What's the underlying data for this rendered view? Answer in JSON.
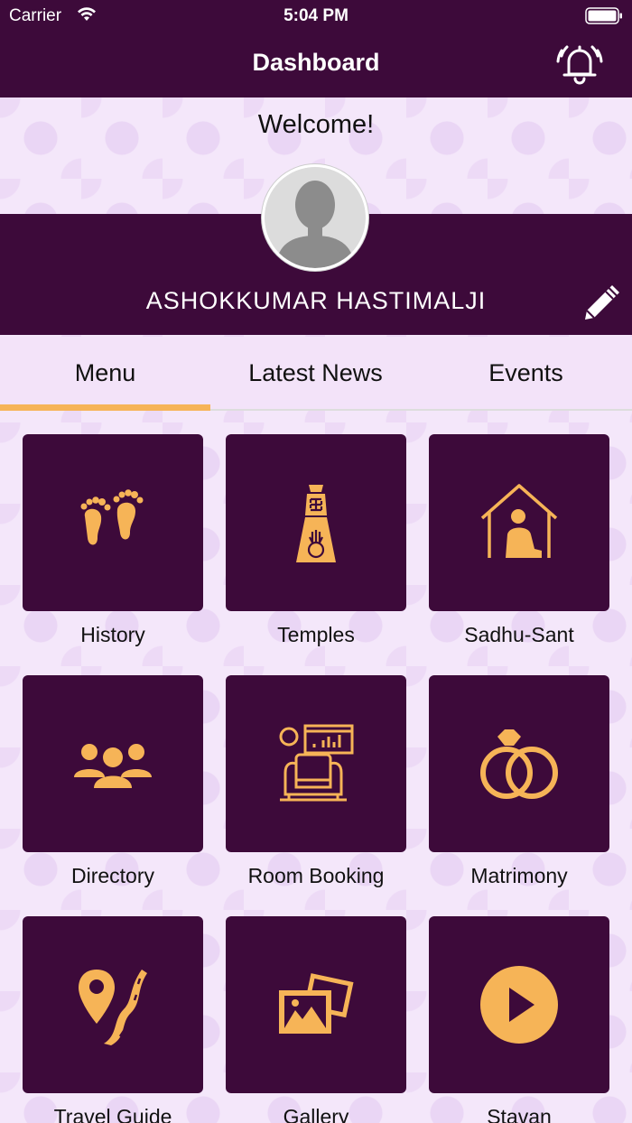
{
  "status_bar": {
    "carrier": "Carrier",
    "time": "5:04 PM"
  },
  "header": {
    "title": "Dashboard"
  },
  "welcome": "Welcome!",
  "user": {
    "name": "ASHOKKUMAR HASTIMALJI"
  },
  "tabs": [
    {
      "label": "Menu",
      "active": true
    },
    {
      "label": "Latest News",
      "active": false
    },
    {
      "label": "Events",
      "active": false
    }
  ],
  "menu": [
    {
      "label": "History",
      "icon": "footprints-icon"
    },
    {
      "label": "Temples",
      "icon": "temple-pillar-icon"
    },
    {
      "label": "Sadhu-Sant",
      "icon": "saint-house-icon"
    },
    {
      "label": "Directory",
      "icon": "people-group-icon"
    },
    {
      "label": "Room Booking",
      "icon": "sofa-room-icon"
    },
    {
      "label": "Matrimony",
      "icon": "rings-icon"
    },
    {
      "label": "Travel Guide",
      "icon": "map-pin-road-icon"
    },
    {
      "label": "Gallery",
      "icon": "photos-icon"
    },
    {
      "label": "Stavan",
      "icon": "play-icon"
    }
  ],
  "colors": {
    "primary": "#3d0a3a",
    "accent": "#f6b457",
    "background": "#f3e6f9"
  }
}
